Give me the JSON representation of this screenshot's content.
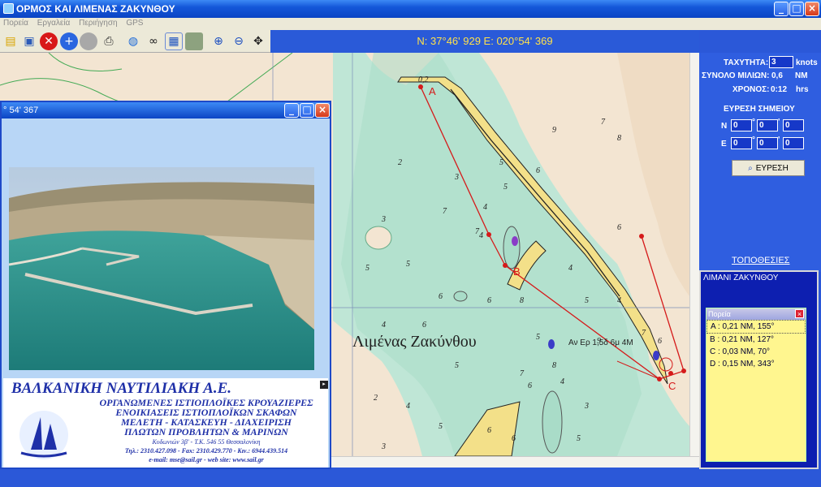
{
  "window": {
    "title": "ΟΡΜΟΣ ΚΑΙ ΛΙΜΕΝΑΣ ΖΑΚΥΝΘΟΥ"
  },
  "menu": [
    "Πορεία",
    "Εργαλεία",
    "Περιήγηση",
    "GPS"
  ],
  "toolbar": {
    "icons": [
      "open-folder-icon",
      "save-icon",
      "stop-icon",
      "add-icon",
      "record-icon",
      "print-icon",
      "globe-icon",
      "binoculars-icon",
      "ruler-icon",
      "grid-icon",
      "zoom-in-icon",
      "zoom-out-icon",
      "pan-icon"
    ]
  },
  "coords": {
    "text": "N: 37°46' 929  E: 020°54' 369"
  },
  "speed": {
    "label": "ΤΑΧΥΤΗΤΑ:",
    "value": "3",
    "unit": "knots"
  },
  "total_miles": {
    "label": "ΣΥΝΟΛΟ ΜΙΛΙΩΝ:",
    "value": "0,6",
    "unit": "NM"
  },
  "time": {
    "label": "ΧΡΟΝΟΣ:",
    "value": "0:12",
    "unit": "hrs"
  },
  "find_point": {
    "title": "ΕΥΡΕΣΗ ΣΗΜΕΙΟΥ",
    "n_label": "N",
    "e_label": "E",
    "n": [
      "0",
      "0",
      "0"
    ],
    "e": [
      "0",
      "0",
      "0"
    ],
    "deg_sep": "°",
    "min_sep": "'",
    "button": "ΕΥΡΕΣΗ"
  },
  "places": {
    "link": "ΤΟΠΟΘΕΣΙΕΣ",
    "items": [
      "ΛΙΜΑΝΙ ΖΑΚΥΝΘΟΥ"
    ]
  },
  "route": {
    "title": "Πορεία",
    "close": "×",
    "legs": [
      "A : 0,21 NM, 155°",
      "B : 0,21 NM, 127°",
      "C : 0,03 NM, 70°",
      "D : 0,15 NM, 343°"
    ]
  },
  "photo_window": {
    "title": "° 54' 367"
  },
  "ad": {
    "company": "ΒΑΛΚΑΝΙΚΗ ΝΑΥΤΙΛΙΑΚΗ Α.Ε.",
    "logo_text": "ΒΑΛΚΑΝΙΚΗ ΝΑΥΤΙΛΙΑΚΗ Α.Ε.",
    "lines": [
      "ΟΡΓΑΝΩΜΕΝΕΣ ΙΣΤΙΟΠΛΟΪΚΕΣ ΚΡΟΥΑΖΙΕΡΕΣ",
      "ΕΝΟΙΚΙΑΣΕΙΣ ΙΣΤΙΟΠΛΟΪΚΩΝ ΣΚΑΦΩΝ",
      "ΜΕΛΕΤΗ - ΚΑΤΑΣΚΕΥΗ - ΔΙΑΧΕΙΡΙΣΗ",
      "ΠΛΩΤΩΝ ΠΡΟΒΛΗΤΩΝ & ΜΑΡΙΝΩΝ"
    ],
    "address": "Κυδωνιών 3β' - Τ.Κ. 546 55 Θεσσαλονίκη",
    "phones": "Τηλ.: 2310.427.098 - Fax: 2310.429.770 - Κιν.: 6944.439.514",
    "web": "e-mail: mse@sail.gr - web site: www.sail.gr"
  },
  "map": {
    "place_label": "Λιμένας Ζακύνθου",
    "light_label": "Αν Ερ 1,5δ 6μ 4Μ",
    "marks": [
      "A",
      "B",
      "C"
    ],
    "depths": [
      "0,2",
      "2",
      "3",
      "4",
      "5",
      "6",
      "7",
      "8",
      "9",
      "3",
      "4",
      "5",
      "6",
      "7",
      "8",
      "4",
      "5",
      "6",
      "7",
      "6",
      "5",
      "4",
      "3",
      "3",
      "4",
      "5",
      "6",
      "7",
      "8",
      "9",
      "7",
      "6",
      "5",
      "4",
      "2",
      "5",
      "6",
      "6",
      "5",
      "6",
      "5",
      "4"
    ]
  }
}
